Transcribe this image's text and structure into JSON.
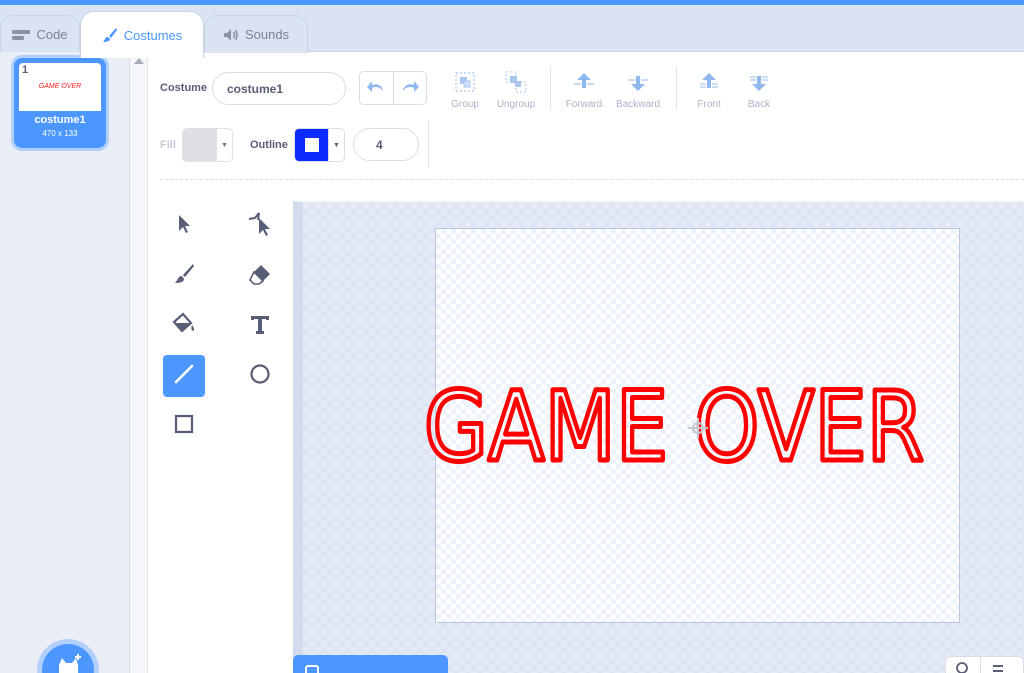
{
  "tabs": [
    {
      "label": "Code",
      "icon": "code-icon"
    },
    {
      "label": "Costumes",
      "icon": "paintbrush-icon"
    },
    {
      "label": "Sounds",
      "icon": "speaker-icon"
    }
  ],
  "sprite_list": {
    "costume": {
      "number": "1",
      "name": "costume1",
      "size": "470 x 133",
      "thumbnail_text": "GAME OVER"
    }
  },
  "toolbar": {
    "costume_label": "Costume",
    "costume_name": "costume1",
    "group_label": "Group",
    "ungroup_label": "Ungroup",
    "forward_label": "Forward",
    "backward_label": "Backward",
    "front_label": "Front",
    "back_label": "Back",
    "fill_label": "Fill",
    "outline_label": "Outline",
    "outline_width": "4"
  },
  "colors": {
    "accent": "#4c97ff",
    "fill_swatch": "#d9d9df",
    "outline_swatch": "#0b2bff",
    "art_text": "#ff0000"
  },
  "tools": [
    "select-tool",
    "reshape-tool",
    "brush-tool",
    "eraser-tool",
    "fill-tool",
    "text-tool",
    "line-tool",
    "circle-tool",
    "rectangle-tool"
  ],
  "active_tool": "line-tool",
  "canvas": {
    "art_text": "GAME OVER"
  }
}
